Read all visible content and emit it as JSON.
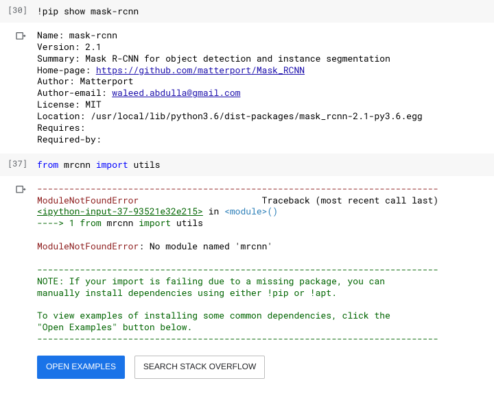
{
  "cell1": {
    "exec_label": "[30]",
    "code_plain": "!pip show mask-rcnn",
    "out_lines": [
      "Name: mask-rcnn",
      "Version: 2.1",
      "Summary: Mask R-CNN for object detection and instance segmentation"
    ],
    "homepage_label": "Home-page: ",
    "homepage_url": "https://github.com/matterport/Mask_RCNN",
    "author_line": "Author: Matterport",
    "author_email_label": "Author-email: ",
    "author_email": "waleed.abdulla@gmail.com",
    "tail_lines": [
      "License: MIT",
      "Location: /usr/local/lib/python3.6/dist-packages/mask_rcnn-2.1-py3.6.egg",
      "Requires: ",
      "Required-by: "
    ]
  },
  "cell2": {
    "exec_label": "[37]",
    "code_from": "from",
    "code_pkg": " mrcnn ",
    "code_import": "import",
    "code_rest": " utils",
    "dash_line": "---------------------------------------------------------------------------",
    "err_name": "ModuleNotFoundError",
    "tb_header_mid": "                       Traceback (most recent call last)",
    "tb_file": "<ipython-input-37-93521e32e215>",
    "tb_in": " in ",
    "tb_module": "<module>",
    "tb_paren": "()",
    "arrow": "----> 1 ",
    "arrow_from": "from",
    "arrow_pkg": " mrcnn ",
    "arrow_import": "import",
    "arrow_rest": " utils",
    "err_msg": ": No module named 'mrcnn'",
    "note_dash": "---------------------------------------------------------------------------",
    "note_lines": [
      "NOTE: If your import is failing due to a missing package, you can",
      "manually install dependencies using either !pip or !apt.",
      "",
      "To view examples of installing some common dependencies, click the",
      "\"Open Examples\" button below."
    ],
    "note_dash2": "---------------------------------------------------------------------------",
    "btn_open": "OPEN EXAMPLES",
    "btn_search": "SEARCH STACK OVERFLOW"
  }
}
